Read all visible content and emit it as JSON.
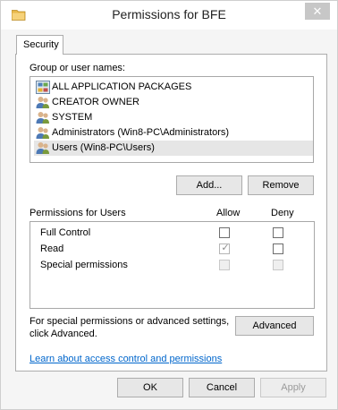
{
  "window": {
    "title": "Permissions for BFE",
    "close_label": "✕"
  },
  "tabs": [
    {
      "label": "Security"
    }
  ],
  "group": {
    "label": "Group or user names:",
    "items": [
      {
        "label": "ALL APPLICATION PACKAGES",
        "icon": "packages-icon"
      },
      {
        "label": "CREATOR OWNER",
        "icon": "users-icon"
      },
      {
        "label": "SYSTEM",
        "icon": "users-icon"
      },
      {
        "label": "Administrators (Win8-PC\\Administrators)",
        "icon": "users-icon"
      },
      {
        "label": "Users (Win8-PC\\Users)",
        "icon": "users-icon",
        "selected": true
      }
    ]
  },
  "buttons": {
    "add": "Add...",
    "remove": "Remove",
    "advanced": "Advanced",
    "ok": "OK",
    "cancel": "Cancel",
    "apply": "Apply"
  },
  "permissions": {
    "label": "Permissions for Users",
    "allow_header": "Allow",
    "deny_header": "Deny",
    "rows": [
      {
        "name": "Full Control",
        "allow": false,
        "deny": false,
        "disabled": false
      },
      {
        "name": "Read",
        "allow": true,
        "deny": false,
        "disabled": false,
        "allow_inherited": true
      },
      {
        "name": "Special permissions",
        "allow": false,
        "deny": false,
        "disabled": true
      }
    ]
  },
  "advanced": {
    "text_line1": "For special permissions or advanced settings,",
    "text_line2": "click Advanced."
  },
  "link": {
    "label": "Learn about access control and permissions"
  },
  "colors": {
    "link": "#0066cc",
    "selection": "#e6e6e6",
    "folder": "#e8b84a"
  }
}
